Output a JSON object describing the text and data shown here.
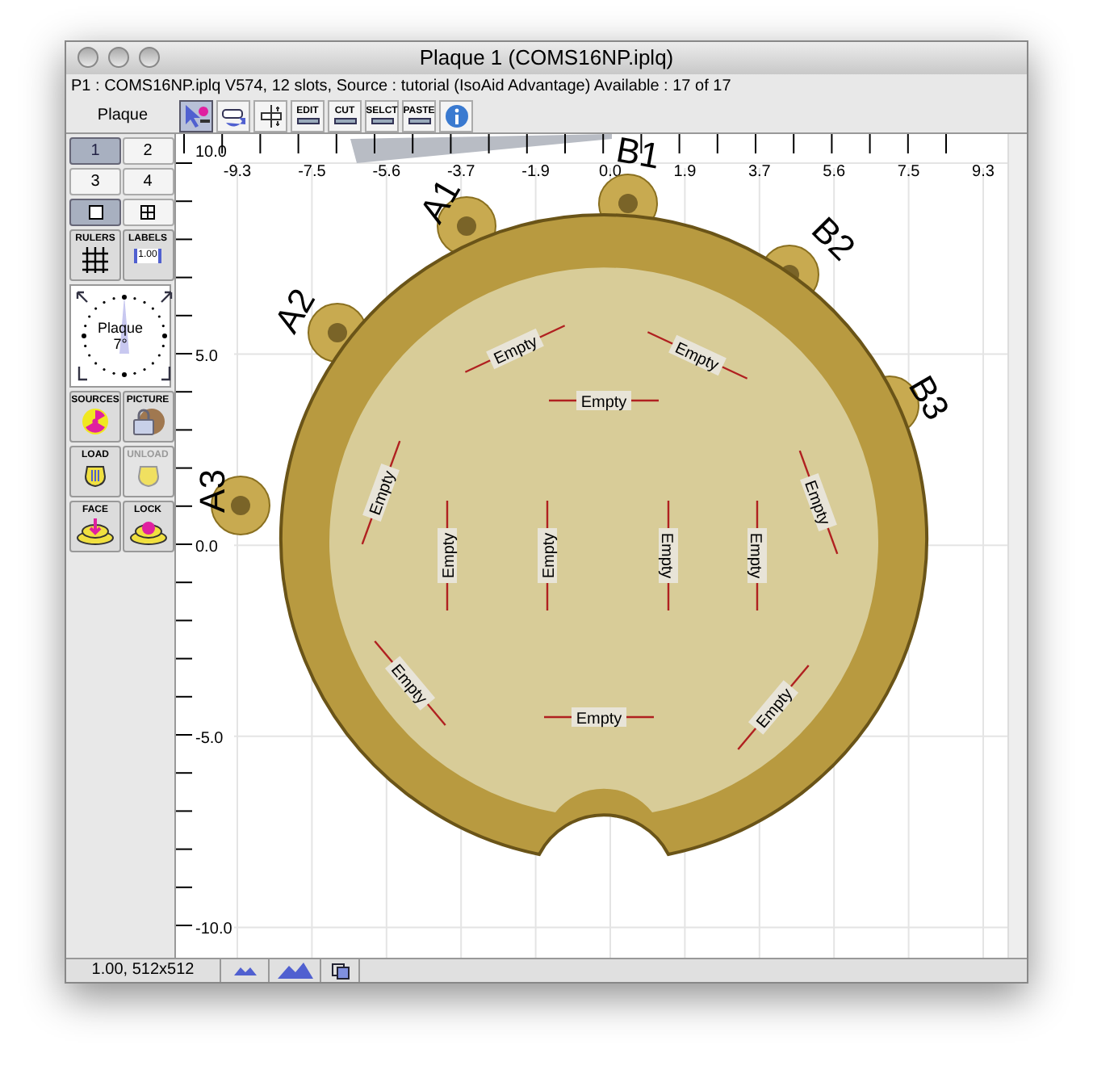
{
  "window": {
    "title": "Plaque 1 (COMS16NP.iplq)"
  },
  "info_line": "P1 : COMS16NP.iplq V574, 12 slots, Source : tutorial (IsoAid Advantage) Available : 17 of 17",
  "toolbar": {
    "label": "Plaque",
    "tools": [
      {
        "kind": "pointer",
        "selected": true
      },
      {
        "kind": "rotate",
        "selected": false
      },
      {
        "kind": "spacing",
        "selected": false
      },
      {
        "kind": "text",
        "text": "EDIT",
        "selected": false
      },
      {
        "kind": "text",
        "text": "CUT",
        "selected": false
      },
      {
        "kind": "text",
        "text": "SELCT",
        "selected": false
      },
      {
        "kind": "text",
        "text": "PASTE",
        "selected": false
      },
      {
        "kind": "info",
        "selected": false
      }
    ]
  },
  "plaque_tabs": [
    {
      "label": "1",
      "selected": true
    },
    {
      "label": "2",
      "selected": false
    },
    {
      "label": "3",
      "selected": false
    },
    {
      "label": "4",
      "selected": false
    }
  ],
  "view_modes": [
    {
      "kind": "single",
      "selected": true
    },
    {
      "kind": "grid",
      "selected": false
    }
  ],
  "settings": [
    {
      "kind": "rulers",
      "label": "RULERS"
    },
    {
      "kind": "labels",
      "label": "LABELS",
      "value": "1.00"
    }
  ],
  "dial": {
    "label": "Plaque",
    "angle": "7°"
  },
  "actions": [
    {
      "kind": "sources",
      "label": "SOURCES",
      "disabled": false
    },
    {
      "kind": "picture",
      "label": "PICTURE",
      "disabled": false
    },
    {
      "kind": "load",
      "label": "LOAD",
      "disabled": false
    },
    {
      "kind": "unload",
      "label": "UNLOAD",
      "disabled": true
    },
    {
      "kind": "face",
      "label": "FACE",
      "disabled": false
    },
    {
      "kind": "lock",
      "label": "LOCK",
      "disabled": false
    }
  ],
  "canvas": {
    "x_ticks": [
      "-9.3",
      "-7.5",
      "-5.6",
      "-3.7",
      "-1.9",
      "0.0",
      "1.9",
      "3.7",
      "5.6",
      "7.5",
      "9.3"
    ],
    "y_ticks": [
      "10.0",
      "5.0",
      "0.0",
      "-5.0",
      "-10.0"
    ],
    "row_labels": [
      "A1",
      "B1",
      "B2",
      "A2",
      "B3",
      "A3"
    ],
    "slots": [
      {
        "label": "Empty"
      },
      {
        "label": "Empty"
      },
      {
        "label": "Empty"
      },
      {
        "label": "Empty"
      },
      {
        "label": "Empty"
      },
      {
        "label": "Empty"
      },
      {
        "label": "Empty"
      },
      {
        "label": "Empty"
      },
      {
        "label": "Empty"
      },
      {
        "label": "Empty"
      },
      {
        "label": "Empty"
      },
      {
        "label": "Empty"
      }
    ]
  },
  "status_bar": {
    "scale": "1.00, 512x512"
  }
}
